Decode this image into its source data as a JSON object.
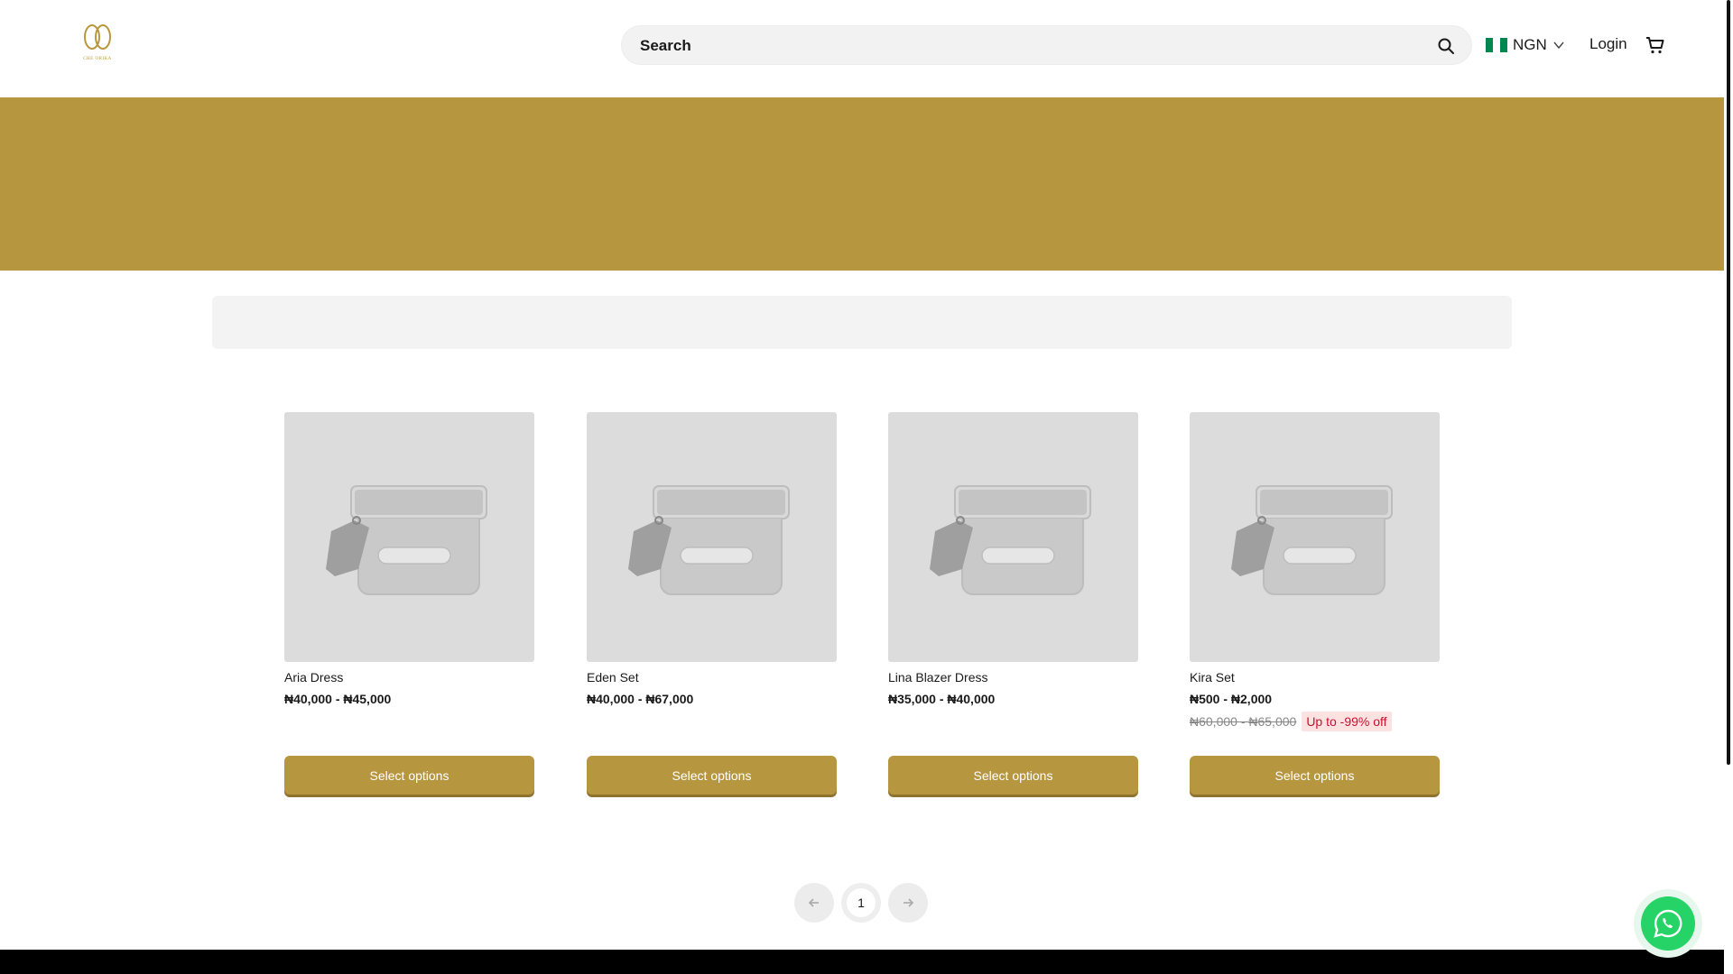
{
  "header": {
    "logo_text": "CHE ORIKA",
    "search_label": "Search",
    "currency_code": "NGN",
    "login_label": "Login"
  },
  "products": [
    {
      "name": "Aria Dress",
      "price": "₦40,000 - ₦45,000",
      "button": "Select options"
    },
    {
      "name": "Eden Set",
      "price": "₦40,000 - ₦67,000",
      "button": "Select options"
    },
    {
      "name": "Lina Blazer Dress",
      "price": "₦35,000 - ₦40,000",
      "button": "Select options"
    },
    {
      "name": "Kira Set",
      "price": "₦500 - ₦2,000",
      "old_price": "₦60,000 - ₦65,000",
      "discount": "Up to -99% off",
      "button": "Select options"
    }
  ],
  "pagination": {
    "current_page": "1",
    "prev_icon": "arrow-left-icon",
    "next_icon": "arrow-right-icon"
  },
  "colors": {
    "brand_gold": "#b79640",
    "discount_red": "#c8102e",
    "whatsapp_green": "#25d366"
  },
  "icons": [
    "logo",
    "search-icon",
    "nigeria-flag-icon",
    "chevron-down-icon",
    "cart-icon",
    "product-placeholder-icon",
    "whatsapp-icon"
  ]
}
